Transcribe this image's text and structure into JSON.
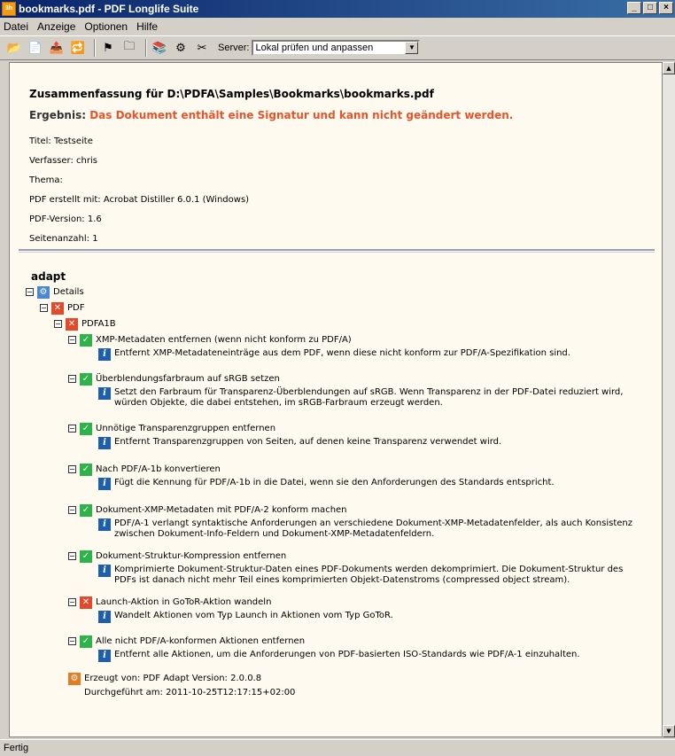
{
  "window": {
    "title": "bookmarks.pdf - PDF Longlife Suite",
    "icon_label": "3h"
  },
  "menu": [
    "Datei",
    "Anzeige",
    "Optionen",
    "Hilfe"
  ],
  "toolbar": {
    "server_label": "Server:",
    "server_value": "Lokal prüfen und anpassen"
  },
  "summary": {
    "title": "Zusammenfassung für D:\\PDFA\\Samples\\Bookmarks\\bookmarks.pdf",
    "result_label": "Ergebnis:",
    "result_text": "Das Dokument enthält eine Signatur und kann nicht geändert werden.",
    "meta": [
      "Titel: Testseite",
      "Verfasser: chris",
      "Thema:",
      "PDF erstellt mit: Acrobat Distiller 6.0.1 (Windows)",
      "PDF-Version: 1.6",
      "Seitenanzahl: 1"
    ]
  },
  "adapt": {
    "heading": "adapt",
    "details_label": "Details",
    "pdf_label": "PDF",
    "pdfa_label": "PDFA1B",
    "items": [
      {
        "status": "ok",
        "title": "XMP-Metadaten entfernen (wenn nicht konform zu PDF/A)",
        "desc": "Entfernt XMP-Metadateneinträge aus dem PDF, wenn diese nicht konform zur PDF/A-Spezifikation sind."
      },
      {
        "status": "ok",
        "title": "Überblendungsfarbraum auf sRGB setzen",
        "desc": "Setzt den Farbraum für Transparenz-Überblendungen auf sRGB. Wenn Transparenz in der PDF-Datei reduziert wird, würden Objekte, die dabei entstehen, im sRGB-Farbraum erzeugt werden."
      },
      {
        "status": "ok",
        "title": "Unnötige Transparenzgruppen entfernen",
        "desc": "Entfernt Transparenzgruppen von Seiten, auf denen keine Transparenz verwendet wird."
      },
      {
        "status": "ok",
        "title": "Nach PDF/A-1b konvertieren",
        "desc": "Fügt die Kennung für PDF/A-1b in die Datei, wenn sie den Anforderungen des Standards entspricht."
      },
      {
        "status": "ok",
        "title": "Dokument-XMP-Metadaten mit PDF/A-2 konform machen",
        "desc": "PDF/A-1 verlangt syntaktische Anforderungen an verschiedene Dokument-XMP-Metadatenfelder, als auch Konsistenz zwischen Dokument-Info-Feldern und Dokument-XMP-Metadatenfeldern."
      },
      {
        "status": "ok",
        "title": "Dokument-Struktur-Kompression entfernen",
        "desc": "Komprimierte Dokument-Struktur-Daten eines PDF-Dokuments werden dekomprimiert. Die Dokument-Struktur des PDFs ist danach nicht mehr Teil eines komprimierten Objekt-Datenstroms (compressed object stream)."
      },
      {
        "status": "fail",
        "title": "Launch-Aktion in GoToR-Aktion wandeln",
        "desc": "Wandelt Aktionen vom Typ Launch in Aktionen vom Typ GoToR."
      },
      {
        "status": "ok",
        "title": "Alle nicht PDF/A-konformen Aktionen entfernen",
        "desc": "Entfernt alle Aktionen, um die Anforderungen von PDF-basierten ISO-Standards wie PDF/A-1 einzuhalten."
      }
    ],
    "generator": "Erzeugt von: PDF Adapt Version: 2.0.0.8",
    "executed": "Durchgeführt am: 2011-10-25T12:17:15+02:00"
  },
  "status": "Fertig",
  "colors": {
    "result_red": "#e8542a",
    "ok_green": "#2db34a",
    "fail_red": "#e34a2c",
    "info_blue": "#1c5fb0"
  }
}
